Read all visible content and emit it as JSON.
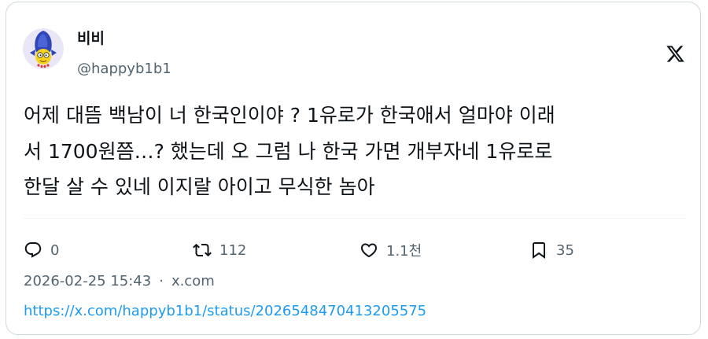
{
  "author": {
    "display_name": "비비",
    "handle": "@happyb1b1",
    "avatar_icon": "avatar-image"
  },
  "brand": {
    "logo_icon": "x-logo-icon"
  },
  "tweet": {
    "text": "어제 대뜸 백남이 너 한국인이야 ? 1유로가 한국애서 얼마야 이래\n서 1700원쯤…? 했는데 오 그럼 나 한국 가면 개부자네 1유로로\n한달 살 수 있네 이지랄 아이고 무식한 놈아"
  },
  "actions": {
    "reply_count": "0",
    "retweet_count": "112",
    "like_count": "1.1천",
    "bookmark_count": "35"
  },
  "meta": {
    "timestamp": "2026-02-25 15:43",
    "separator": "·",
    "source": "x.com",
    "permalink": "https://x.com/happyb1b1/status/2026548470413205575"
  },
  "colors": {
    "text": "#0f1419",
    "secondary": "#536471",
    "link": "#1d9bf0",
    "border": "#cfd9de"
  }
}
